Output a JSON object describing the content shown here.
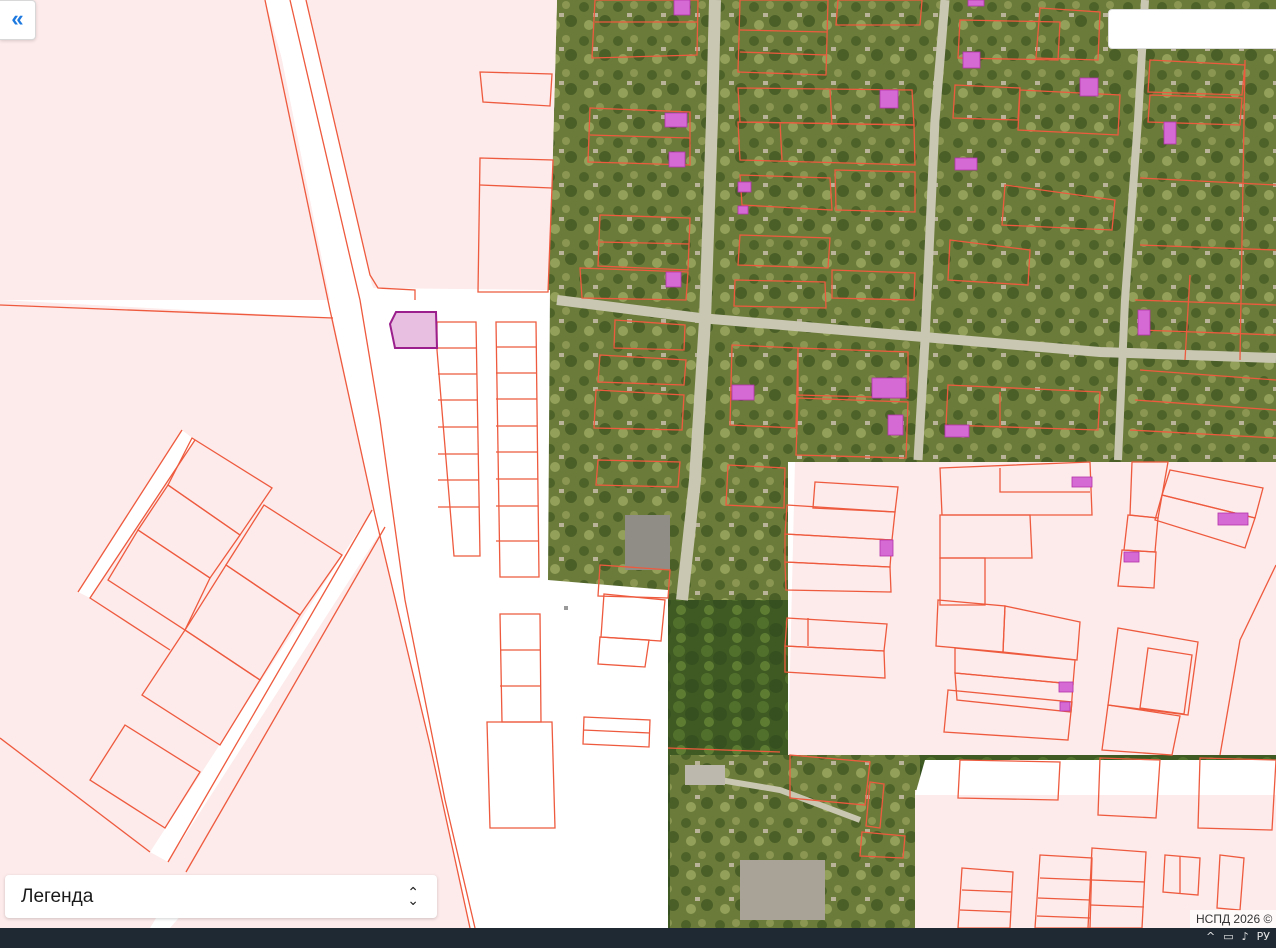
{
  "map": {
    "legend_label": "Легенда",
    "attribution": "НСПД 2026 ©",
    "search_value": "",
    "colors": {
      "parcel_fill": "#fdeaea",
      "parcel_stroke": "#ee5a3e",
      "highlight_fill": "#e8bfe0",
      "highlight_stroke": "#9b1f8c",
      "building": "#d44fd0",
      "imagery_dark": "#5d6e34",
      "imagery_mid": "#7d8a4a",
      "road": "#c4c2b0"
    },
    "icons": {
      "collapse": "double-chevron-left-icon",
      "legend_toggle": "chevron-up-down-icon"
    }
  },
  "taskbar": {
    "tray_icons": [
      "chevron-up-icon",
      "network-icon",
      "speaker-icon",
      "language-icon"
    ],
    "language": "РУ"
  }
}
